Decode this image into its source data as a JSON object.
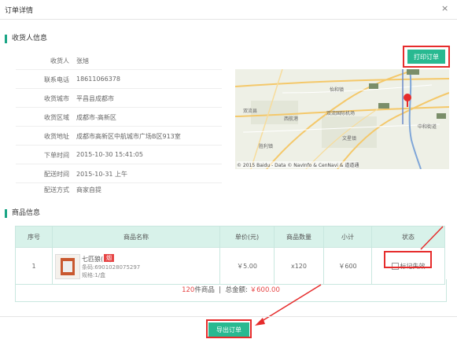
{
  "dialog": {
    "title": "订单详情",
    "close_symbol": "×"
  },
  "receiver_section": {
    "title": "收货人信息",
    "rows": [
      {
        "label": "收货人",
        "value": "张旭"
      },
      {
        "label": "联系电话",
        "value": "18611066378"
      },
      {
        "label": "收货城市",
        "value": "平昌县成都市"
      },
      {
        "label": "收货区域",
        "value": "成都市-高新区"
      },
      {
        "label": "收货地址",
        "value": "成都市高新区中航城市广场B区913室"
      },
      {
        "label": "下单时间",
        "value": "2015-10-30 15:41:05"
      },
      {
        "label": "配送时间",
        "value": "2015-10-31 上午"
      },
      {
        "label": "配送方式",
        "value": "商家自提"
      }
    ]
  },
  "print_button": "打印订单",
  "map": {
    "copyright": "© 2015 Baidu - Data © NavInfo & CenNavi & 道道通",
    "labels": [
      "G4201",
      "G4201",
      "S8",
      "G42",
      "双流县",
      "双流国际机场",
      "西航港",
      "中和街道",
      "文星镇",
      "怡和镇",
      "胜利镇",
      "G5"
    ]
  },
  "product_section": {
    "title": "商品信息",
    "columns": [
      "序号",
      "商品名称",
      "单价(元)",
      "商品数量",
      "小计",
      "状态"
    ],
    "rows": [
      {
        "index": "1",
        "name": "七匹狼(白)",
        "tag": "烟",
        "code": "条码:6901028075297",
        "spec": "规格:1/盒",
        "price": "￥5.00",
        "qty": "x120",
        "subtotal": "￥600",
        "status": "标记失效"
      }
    ],
    "summary": {
      "count": "120",
      "count_suffix": "件商品",
      "separator": "|",
      "total_label": "总金额:",
      "total": "￥600.00"
    }
  },
  "export_button": "导出订单",
  "colors": {
    "accent": "#29b991",
    "highlight": "#e62c2c",
    "price": "#e64545"
  }
}
